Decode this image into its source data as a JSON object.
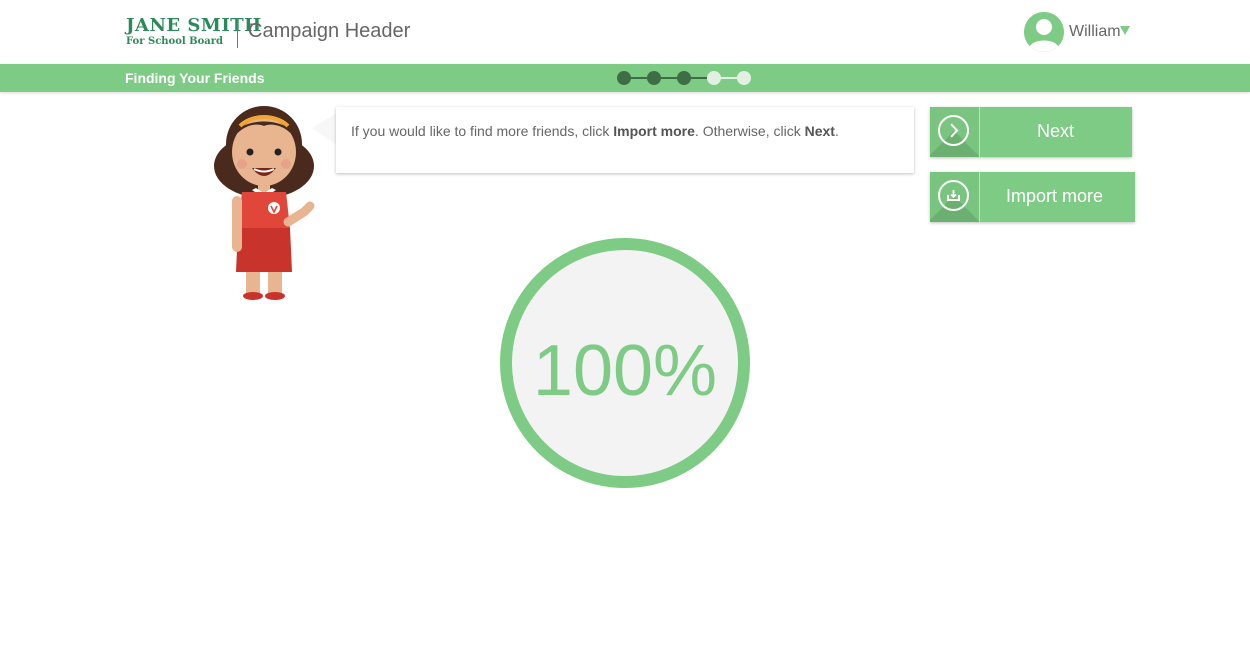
{
  "header": {
    "logo_line1": "JANE SMITH",
    "logo_line2": "For School Board",
    "campaign_title": "Campaign Header",
    "user_name": "William"
  },
  "stepbar": {
    "title": "Finding Your Friends",
    "steps_total": 5,
    "steps_completed": 3
  },
  "bubble": {
    "text_before": "If you would like to find more friends, click ",
    "bold1": "Import more",
    "text_middle": ". Otherwise, click ",
    "bold2": "Next",
    "text_after": "."
  },
  "buttons": {
    "next_label": "Next",
    "import_label": "Import more"
  },
  "progress": {
    "value_text": "100%",
    "percent": 100
  },
  "icons": {
    "next": "chevron-right-icon",
    "import": "download-tray-icon",
    "avatar": "user-avatar-icon"
  },
  "colors": {
    "accent": "#7dcb84",
    "step_done": "#3e6e45",
    "step_todo": "#e4efe4",
    "brand": "#2c8a5a"
  }
}
